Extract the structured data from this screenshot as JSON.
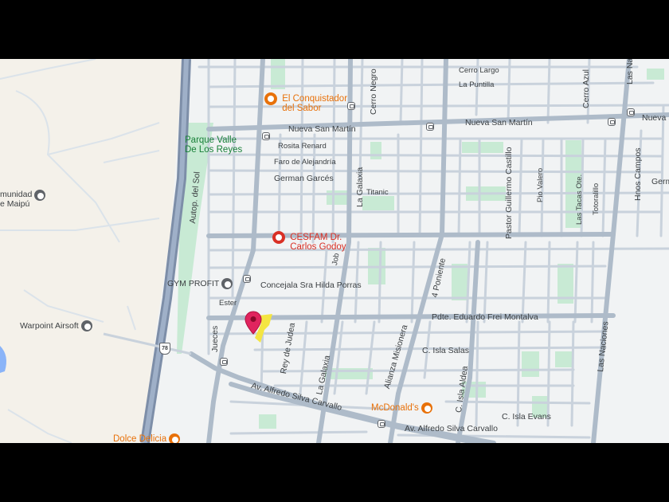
{
  "colors": {
    "restaurant": "#e8710a",
    "health": "#d93025",
    "park": "#188038",
    "place": "#5f6368",
    "road": "#c9d2dc",
    "highway": "#8a9bb5",
    "marker": "#e0245e"
  },
  "pois": {
    "conquistador_l1": "El Conquistador",
    "conquistador_l2": "del Sabor",
    "cesfam_l1": "CESFAM Dr.",
    "cesfam_l2": "Carlos Godoy",
    "parque_l1": "Parque Valle",
    "parque_l2": "De Los Reyes",
    "comunidad_l1": "munidad",
    "comunidad_l2": "e Maipú",
    "gym": "GYM PROFIT",
    "warpoint": "Warpoint Airsoft",
    "mcdonalds": "McDonald's",
    "dolce": "Dolce Delicia"
  },
  "streets": {
    "nueva_san_martin_1": "Nueva San Martín",
    "nueva_san_martin_2": "Nueva San Martín",
    "nueva_san_martin_3": "Nueva San",
    "rosita": "Rosita Renard",
    "faro": "Faro de Alejandría",
    "german1": "German Garcés",
    "german2": "Germ",
    "titanic": "Titanic",
    "concejala": "Concejala Sra Hilda Porras",
    "ester": "Ester",
    "frei": "Pdte. Eduardo Frei Montalva",
    "isla_salas": "C. Isla Salas",
    "isla_evans": "C. Isla Evans",
    "silva1": "Av. Alfredo Silva Carvallo",
    "silva2": "Av. Alfredo Silva Carvallo",
    "cerro_largo": "Cerro Largo",
    "la_puntilla": "La Puntilla",
    "cerro_negro": "Cerro Negro",
    "cerro_azul": "Cerro Azul",
    "las_na": "Las Na",
    "la_galaxia1": "La Galaxia",
    "la_galaxia2": "La Galaxia",
    "pastor": "Pastor Guillermo Castillo",
    "pio_valero": "Pio Valero",
    "las_tacas": "Las Tacas Ote.",
    "totoralillo": "Totoralillo",
    "hnos": "Hnos Campos",
    "autop": "Autop. del Sol",
    "jueces": "Jueces",
    "rey": "Rey de Judea",
    "jobs": "Job",
    "cuatro_poniente": "4 Poniente",
    "alianza": "Alianza Misionera",
    "isla_aldea": "C. Isla Aldea",
    "las_naciones": "Las Naciones",
    "route": "78"
  }
}
